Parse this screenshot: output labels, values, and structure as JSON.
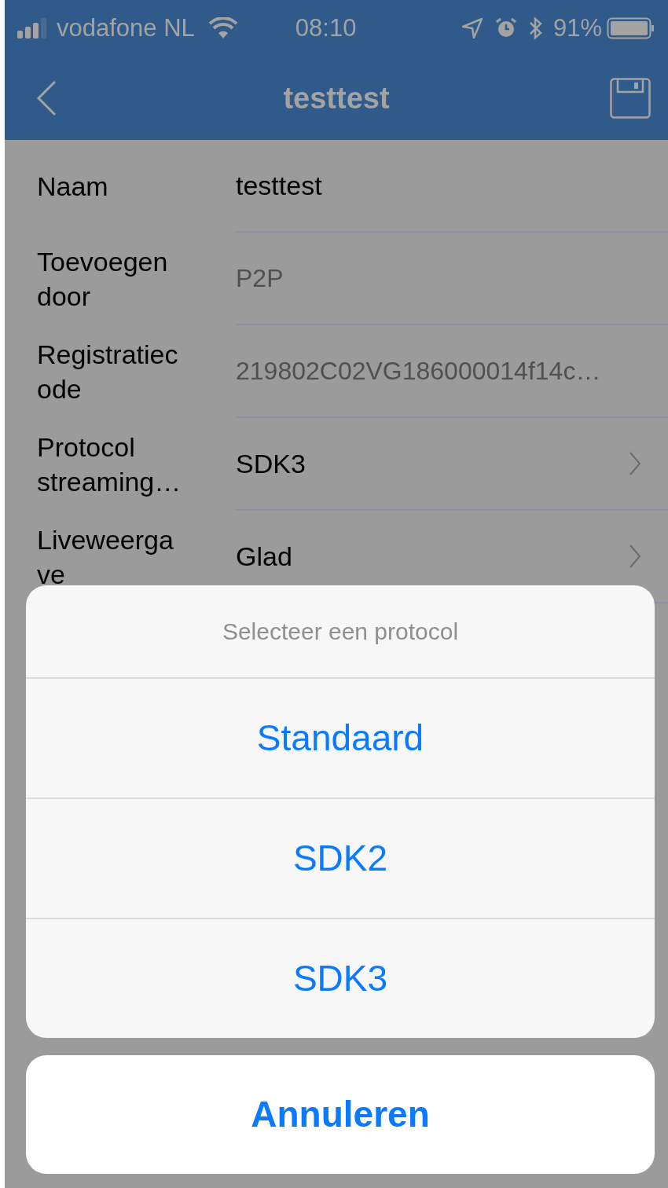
{
  "status_bar": {
    "carrier": "vodafone NL",
    "time": "08:10",
    "battery": "91%"
  },
  "nav": {
    "title": "testtest"
  },
  "fields": [
    {
      "label_lines": [
        "Naam"
      ],
      "value": "testtest",
      "kind": "text"
    },
    {
      "label_lines": [
        "Toevoegen",
        "door"
      ],
      "value": "P2P",
      "kind": "readonly"
    },
    {
      "label_lines": [
        "Registratiec",
        "ode"
      ],
      "value": "219802C02VG186000014f14c…",
      "kind": "readonly"
    },
    {
      "label_lines": [
        "Protocol",
        "streaming…"
      ],
      "value": "SDK3",
      "kind": "picker"
    },
    {
      "label_lines": [
        "Liveweerga",
        "ve"
      ],
      "value": "Glad",
      "kind": "picker"
    }
  ],
  "action_sheet": {
    "title": "Selecteer een protocol",
    "options": [
      "Standaard",
      "SDK2",
      "SDK3"
    ],
    "cancel": "Annuleren"
  }
}
